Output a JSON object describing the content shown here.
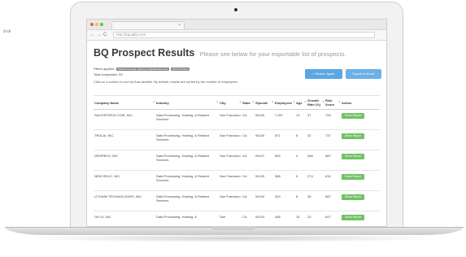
{
  "browser": {
    "url": "http://bqualify.com",
    "nav": {
      "back": "←",
      "forward": "→",
      "reload": "C"
    },
    "tab_close": "×"
  },
  "page": {
    "title": "BQ Prospect Results",
    "subtitle": "Please see below for your exportable list of prospects.",
    "filters_label": "Filters applied:",
    "filters": [
      "Data Processing, Hosting, & Related Services",
      "San Francisco"
    ],
    "total_companies": "Total companies: 99",
    "hint": "Click on a column to sort by that variable. By default, results are sorted by the number of employees.",
    "search_again_label": "Search Again",
    "export_label": "Export to Excel"
  },
  "table": {
    "columns": [
      "Company Name",
      "Industry",
      "City",
      "State",
      "Zipcode",
      "Employees",
      "Age",
      "Growth Rate (%)",
      "Risk Score",
      "Action"
    ],
    "rows": [
      [
        "SALESFORCE.COM, INC.",
        "Data Processing, Hosting, & Related Services",
        "San Francisco",
        "CA",
        "94105",
        "7,267",
        "13",
        "37",
        "725",
        "Show Report"
      ],
      [
        "TRULIA, INC.",
        "Data Processing, Hosting, & Related Services",
        "San Francisco",
        "CA",
        "94105",
        "871",
        "8",
        "42",
        "737",
        "Show Report"
      ],
      [
        "DROPBOX, INC",
        "Data Processing, Hosting, & Related Services",
        "San Francisco",
        "CA",
        "94107",
        "554",
        "4",
        "466",
        "587",
        "Show Report"
      ],
      [
        "NEW RELIC, INC.",
        "Data Processing, Hosting, & Related Services",
        "San Francisco",
        "CA",
        "94105",
        "388",
        "5",
        "274",
        "616",
        "Show Report"
      ],
      [
        "LITHIUM TECHNOLOGIES, INC.",
        "Data Processing, Hosting, & Related Services",
        "San Francisco",
        "CA",
        "94104",
        "300",
        "8",
        "28",
        "687",
        "Show Report"
      ],
      [
        "OH 24, INC.",
        "Data Processing, Hosting, &",
        "San",
        "CA",
        "94103",
        "288",
        "15",
        "23",
        "647",
        "Show Report"
      ]
    ]
  },
  "side_note": "d\nck",
  "colors": {
    "primary_button": "#5aa6e2",
    "action_button": "#72c166",
    "title": "#3a3a3a"
  }
}
